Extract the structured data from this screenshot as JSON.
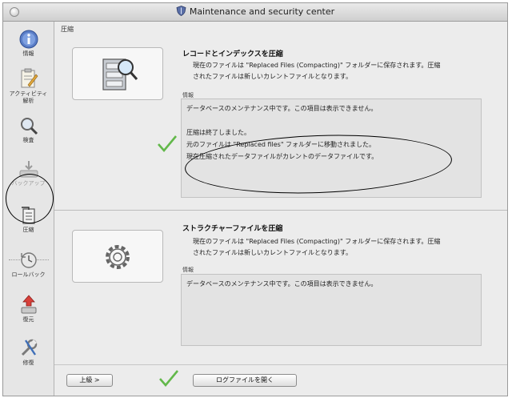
{
  "window": {
    "title": "Maintenance and security center"
  },
  "sidebar": {
    "items": [
      {
        "label": "情報",
        "icon": "info-icon"
      },
      {
        "label": "アクティビティ\n解析",
        "icon": "activity-icon"
      },
      {
        "label": "検査",
        "icon": "magnifier-icon"
      },
      {
        "label": "バックアップ",
        "icon": "backup-icon",
        "disabled": true
      },
      {
        "label": "圧縮",
        "icon": "compact-icon",
        "selected": true
      },
      {
        "label": "ロールバック",
        "icon": "rollback-icon"
      },
      {
        "label": "復元",
        "icon": "restore-icon"
      },
      {
        "label": "修復",
        "icon": "repair-icon"
      }
    ]
  },
  "main": {
    "title": "圧縮",
    "records": {
      "heading": "レコードとインデックスを圧縮",
      "desc_line1": "現在のファイルは \"Replaced Files (Compacting)\" フォルダーに保存されます。圧縮",
      "desc_line2": "されたファイルは新しいカレントファイルとなります。",
      "info_label": "情報",
      "info_lines": [
        "データベースのメンテナンス中です。この項目は表示できません。",
        "",
        "圧縮は終了しました。",
        "元のファイルは \"Replaced files\" フォルダーに移動されました。",
        "現在圧縮されたデータファイルがカレントのデータファイルです。"
      ]
    },
    "structure": {
      "heading": "ストラクチャーファイルを圧縮",
      "desc_line1": "現在のファイルは \"Replaced Files (Compacting)\" フォルダーに保存されます。圧縮",
      "desc_line2": "されたファイルは新しいカレントファイルとなります。",
      "info_label": "情報",
      "info_lines": [
        "データベースのメンテナンス中です。この項目は表示できません。"
      ]
    }
  },
  "footer": {
    "advanced_label": "上級 >",
    "open_log_label": "ログファイルを開く"
  },
  "colors": {
    "check_green": "#62b84a",
    "annotation": "#000000"
  }
}
